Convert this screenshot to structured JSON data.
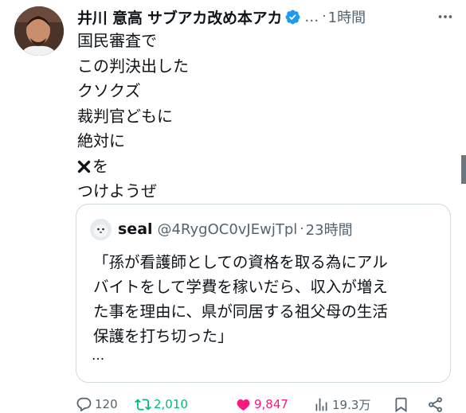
{
  "author": {
    "display_name": "井川 意高 サブアカ改め本アカ",
    "handle": "…",
    "separator": "·",
    "time": "1時間"
  },
  "body_lines": [
    "国民審査で",
    "この判決出した",
    "クソクズ",
    "裁判官どもに",
    "絶対に",
    "を",
    "つけようぜ"
  ],
  "quote": {
    "name": "seal",
    "handle": "@4RygOC0vJEwjTpl",
    "separator": "·",
    "time": "23時間",
    "lines": [
      "「孫が看護師としての資格を取る為にアル",
      "バイトをして学費を稼いだら、収入が増え",
      "た事を理由に、県が同居する祖父母の生活",
      "保護を打ち切った」"
    ],
    "ellipsis": "..."
  },
  "actions": {
    "replies": "120",
    "retweets": "2,010",
    "likes": "9,847",
    "views": "19.3万"
  },
  "icons": {
    "verified": "verified-badge-icon",
    "more": "more-dots-icon",
    "cross": "cross-mark-icon",
    "reply": "reply-icon",
    "retweet": "retweet-icon",
    "like": "heart-icon",
    "views": "views-icon",
    "bookmark": "bookmark-icon",
    "share": "share-icon"
  },
  "colors": {
    "text": "#0f1419",
    "secondary": "#536471",
    "verified": "#1d9bf0",
    "retweet_active": "#00ba7c",
    "like_active": "#f91880",
    "border": "#cfd9de"
  }
}
